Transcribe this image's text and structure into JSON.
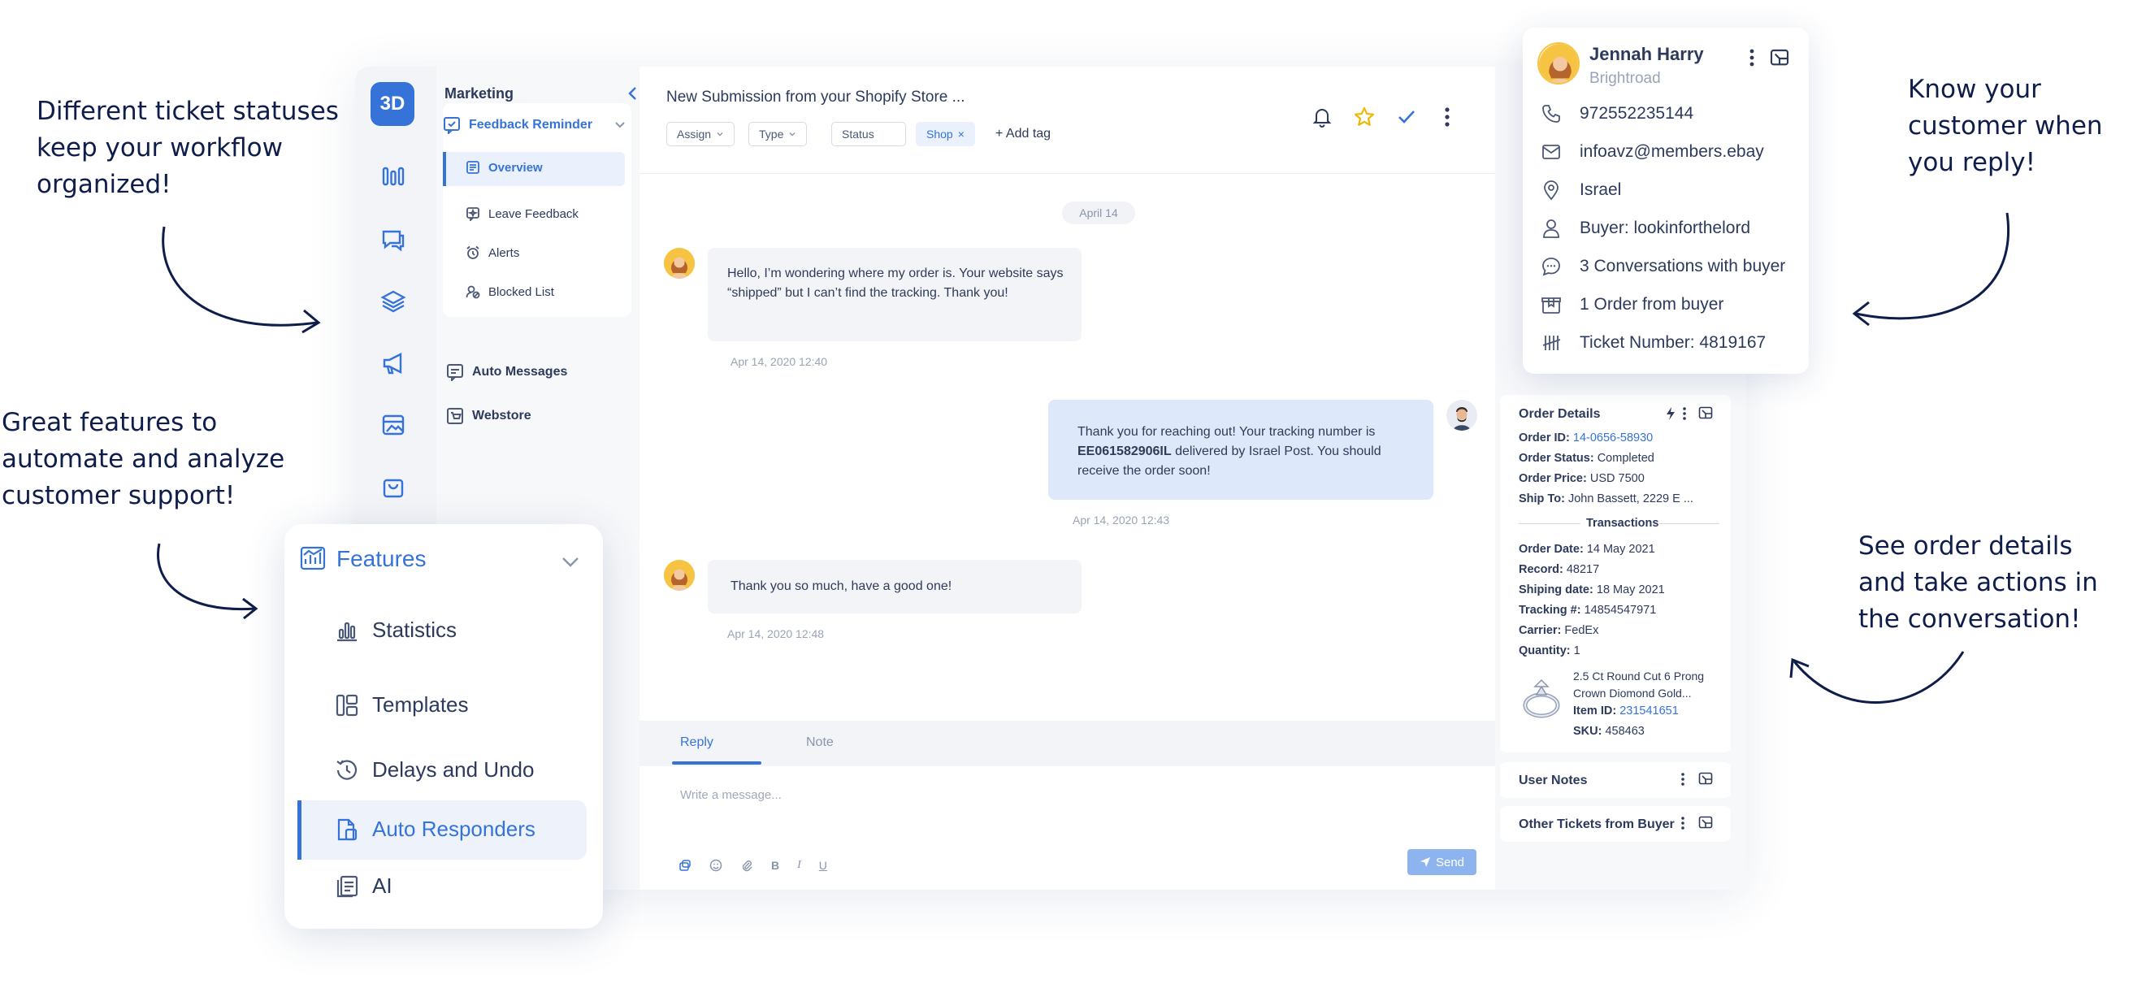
{
  "callouts": {
    "statuses": "Different ticket statuses keep your workflow organized!",
    "features": "Great features to automate and analyze customer support!",
    "know": "Know your customer when you reply!",
    "order": "See order details and take actions in the conversation!"
  },
  "app": {
    "logo": "3D",
    "subnav": {
      "section": "Marketing",
      "group": "Feedback Reminder",
      "items": [
        "Overview",
        "Leave Feedback",
        "Alerts",
        "Blocked List"
      ],
      "auto_messages": "Auto Messages",
      "webstore": "Webstore"
    },
    "chat": {
      "title": "New Submission from your Shopify Store ...",
      "filters": [
        "Assign",
        "Type",
        "Status"
      ],
      "tag": "Shop",
      "add_tag": "+ Add tag",
      "date_divider": "April 14",
      "messages": [
        {
          "text": "Hello, I’m wondering where my order is. Your website says “shipped” but I can’t find the tracking. Thank you!",
          "time": "Apr 14, 2020 12:40"
        },
        {
          "text_before": "Thank you for reaching out! Your tracking number is ",
          "tracking": "EE061582906IL",
          "text_after": " delivered by Israel Post. You should receive the order soon!",
          "time": "Apr 14, 2020 12:43"
        },
        {
          "text": "Thank you so much, have a good one!",
          "time": "Apr 14, 2020 12:48"
        }
      ],
      "tabs": [
        "Reply",
        "Note"
      ],
      "placeholder": "Write a message...",
      "send": "Send"
    },
    "order": {
      "title": "Order Details",
      "order_id_label": "Order ID:",
      "order_id": "14-0656-58930",
      "status_label": "Order Status:",
      "status": "Completed",
      "price_label": "Order Price:",
      "price": "USD 7500",
      "ship_label": "Ship To:",
      "ship": "John Bassett, 2229 E ...",
      "transactions": "Transactions",
      "date_label": "Order Date:",
      "date": "14 May 2021",
      "record_label": "Record:",
      "record": "48217",
      "ship_date_label": "Shiping date:",
      "ship_date": "18 May 2021",
      "tracking_label": "Tracking #:",
      "tracking": "14854547971",
      "carrier_label": "Carrier:",
      "carrier": "FedEx",
      "qty_label": "Quantity:",
      "qty": "1",
      "product_name": "2.5 Ct Round Cut 6 Prong Crown Diomond Gold...",
      "item_label": "Item ID:",
      "item_id": "231541651",
      "sku_label": "SKU:",
      "sku": "458463",
      "user_notes": "User Notes",
      "other_tickets": "Other Tickets from Buyer"
    }
  },
  "contact": {
    "name": "Jennah Harry",
    "company": "Brightroad",
    "phone": "972552235144",
    "email": "infoavz@members.ebay",
    "location": "Israel",
    "buyer": "Buyer: lookinforthelord",
    "conversations": "3 Conversations with buyer",
    "orders": "1 Order from buyer",
    "ticket": "Ticket Number: 4819167"
  },
  "features": {
    "title": "Features",
    "items": [
      "Statistics",
      "Templates",
      "Delays and Undo",
      "Auto Responders",
      "AI"
    ]
  },
  "colors": {
    "accent": "#3573d9",
    "navy": "#0f1d4a",
    "send": "#8db4ee",
    "reply_bubble": "#dde8fb"
  }
}
